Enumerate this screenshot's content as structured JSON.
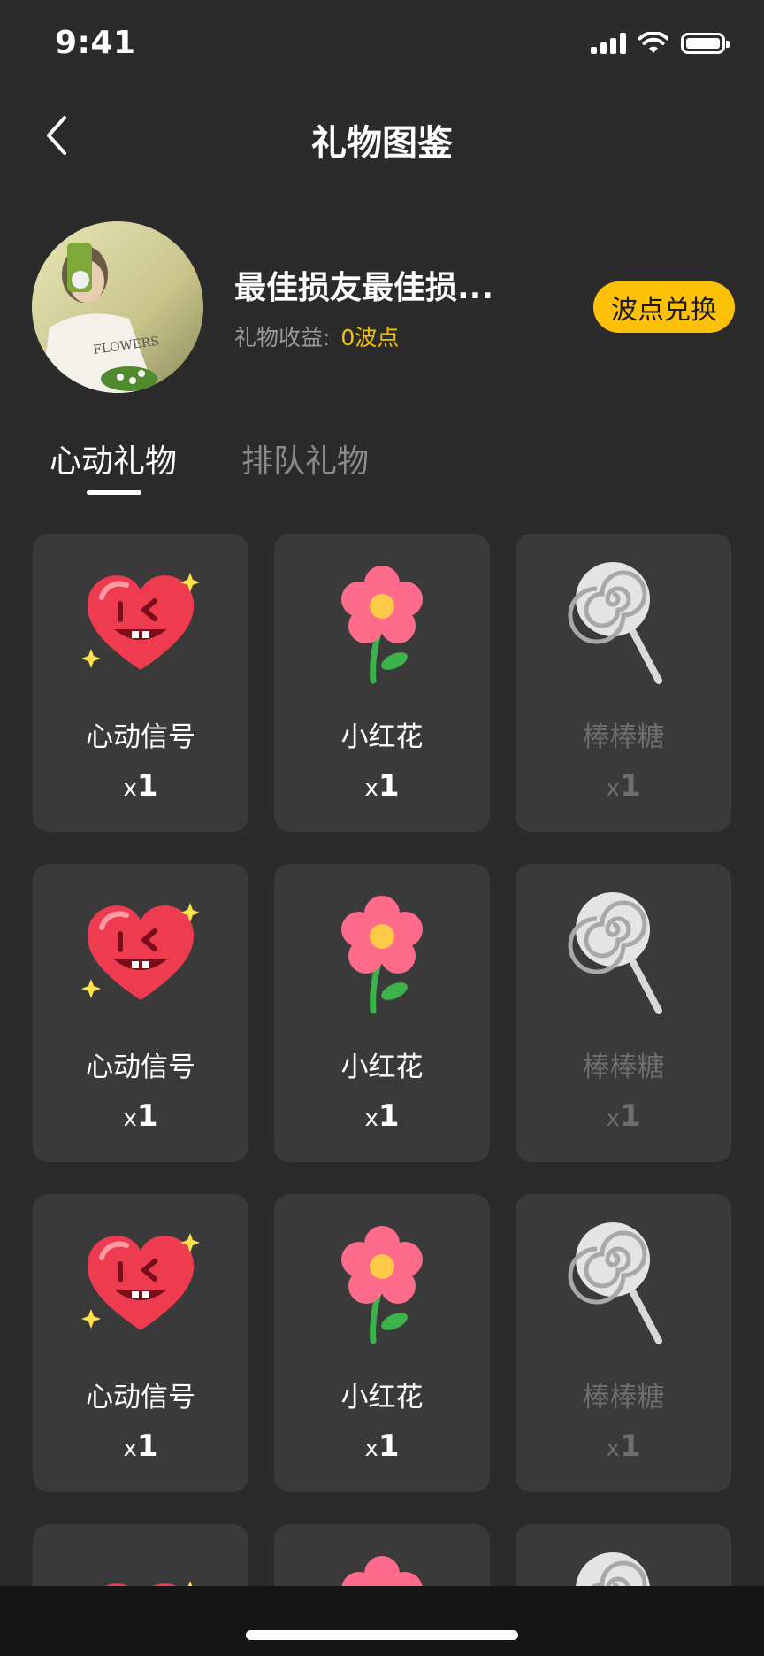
{
  "status_bar": {
    "time": "9:41"
  },
  "nav": {
    "title": "礼物图鉴"
  },
  "profile": {
    "name": "最佳损友最佳损...",
    "income_label": "礼物收益:",
    "income_value": "0波点",
    "exchange_label": "波点兑换"
  },
  "tabs": [
    {
      "label": "心动礼物",
      "active": true
    },
    {
      "label": "排队礼物",
      "active": false
    }
  ],
  "gifts": [
    {
      "name": "心动信号",
      "count_prefix": "x",
      "count": "1",
      "icon": "heart-gift-icon"
    },
    {
      "name": "小红花",
      "count_prefix": "x",
      "count": "1",
      "icon": "flower-gift-icon"
    },
    {
      "name": "棒棒糖",
      "count_prefix": "x",
      "count": "1",
      "icon": "lollipop-gift-icon",
      "dimmed": true
    },
    {
      "name": "心动信号",
      "count_prefix": "x",
      "count": "1",
      "icon": "heart-gift-icon"
    },
    {
      "name": "小红花",
      "count_prefix": "x",
      "count": "1",
      "icon": "flower-gift-icon"
    },
    {
      "name": "棒棒糖",
      "count_prefix": "x",
      "count": "1",
      "icon": "lollipop-gift-icon",
      "dimmed": true
    },
    {
      "name": "心动信号",
      "count_prefix": "x",
      "count": "1",
      "icon": "heart-gift-icon"
    },
    {
      "name": "小红花",
      "count_prefix": "x",
      "count": "1",
      "icon": "flower-gift-icon"
    },
    {
      "name": "棒棒糖",
      "count_prefix": "x",
      "count": "1",
      "icon": "lollipop-gift-icon",
      "dimmed": true
    }
  ],
  "colors": {
    "background": "#2b2b2b",
    "card": "#3a3a3a",
    "accent": "#ffc107",
    "income_value": "#f5c000"
  }
}
